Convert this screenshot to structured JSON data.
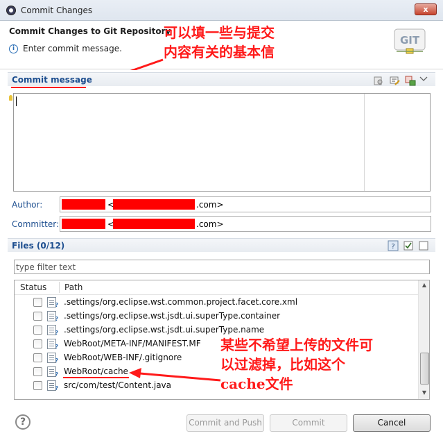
{
  "window": {
    "title": "Commit Changes",
    "close_label": "x"
  },
  "header": {
    "title": "Commit Changes to Git Repository",
    "message": "Enter commit message.",
    "logo_text": "GIT"
  },
  "annotations": {
    "top": [
      "可以填一些与提交",
      "内容有关的基本信"
    ],
    "bottom": [
      "某些不希望上传的文件可",
      "以过滤掉，比如这个",
      "cache文件"
    ]
  },
  "commit_message": {
    "section_title": "Commit message",
    "value": ""
  },
  "author": {
    "label": "Author:",
    "email_suffix": ".com>",
    "open_bracket": "<"
  },
  "committer": {
    "label": "Committer:",
    "email_suffix": ".com>",
    "open_bracket": "<"
  },
  "files": {
    "section_title": "Files (0/12)",
    "filter_placeholder": "type filter text",
    "columns": [
      "Status",
      "Path"
    ],
    "rows": [
      {
        "path": ".settings/org.eclipse.wst.common.project.facet.core.xml",
        "checked": false
      },
      {
        "path": ".settings/org.eclipse.wst.jsdt.ui.superType.container",
        "checked": false
      },
      {
        "path": ".settings/org.eclipse.wst.jsdt.ui.superType.name",
        "checked": false
      },
      {
        "path": "WebRoot/META-INF/MANIFEST.MF",
        "checked": false
      },
      {
        "path": "WebRoot/WEB-INF/.gitignore",
        "checked": false
      },
      {
        "path": "WebRoot/cache",
        "checked": false
      },
      {
        "path": "src/com/test/Content.java",
        "checked": false
      }
    ]
  },
  "buttons": {
    "commit_and_push": "Commit and Push",
    "commit": "Commit",
    "cancel": "Cancel",
    "help": "?"
  },
  "colors": {
    "annotation": "#ff1a1a",
    "section_title": "#1d4e8f",
    "redaction": "#ff0000"
  }
}
